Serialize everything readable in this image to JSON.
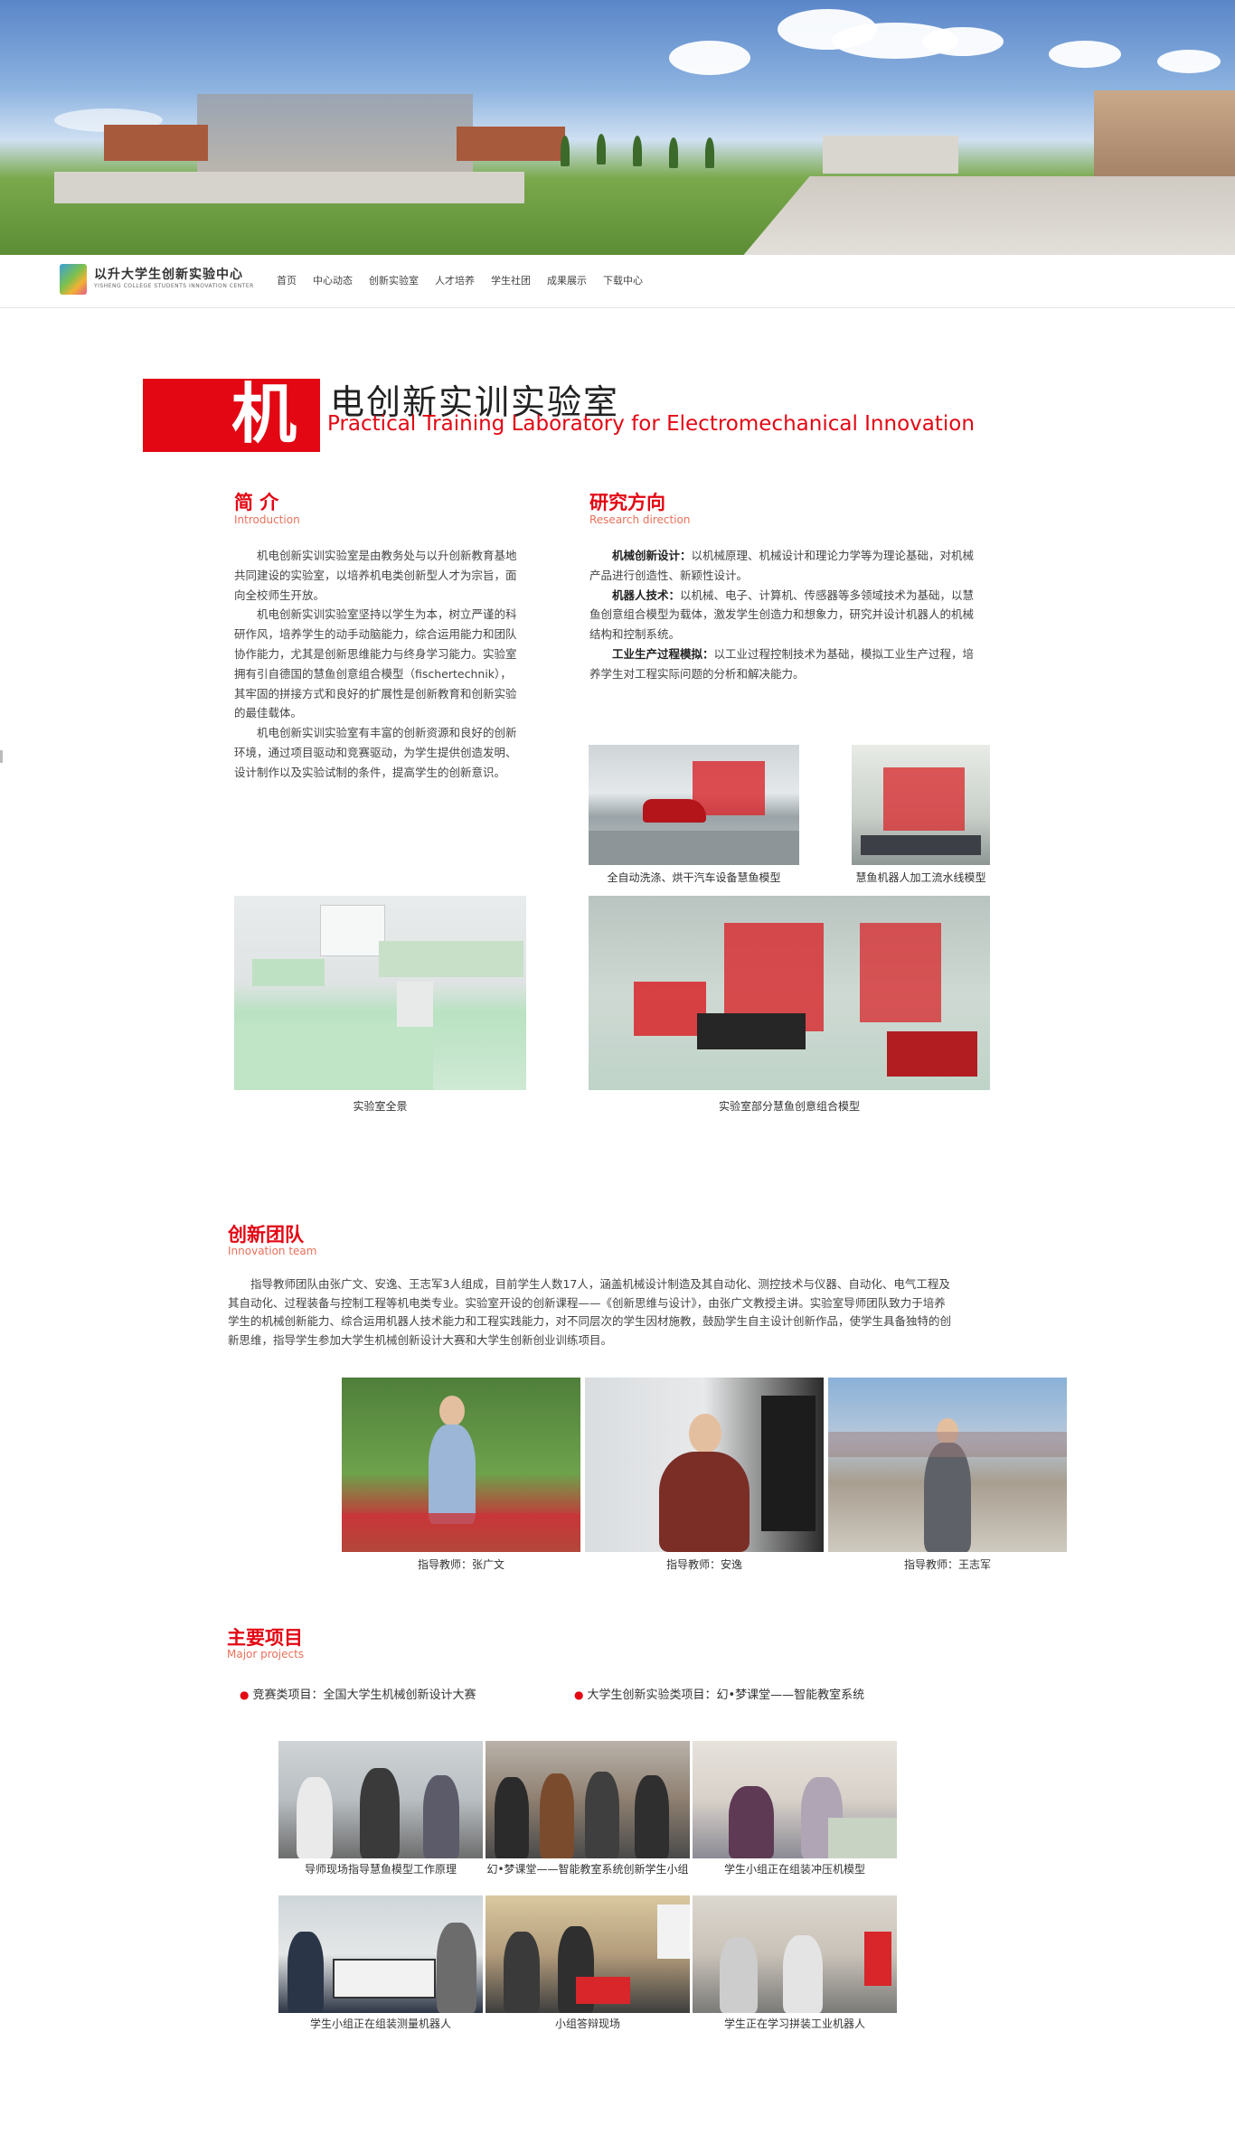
{
  "header": {
    "logo": {
      "cn": "以升大学生创新实验中心",
      "en": "YISHENG COLLEGE STUDENTS INNOVATION CENTER"
    },
    "menu": [
      "首页",
      "中心动态",
      "创新实验室",
      "人才培养",
      "学生社团",
      "成果展示",
      "下载中心"
    ]
  },
  "title": {
    "char": "机",
    "cn": "电创新实训实验室",
    "en": "Practical Training Laboratory for Electromechanical Innovation"
  },
  "intro": {
    "heading_cn": "简 介",
    "heading_en": "Introduction",
    "paragraphs": [
      "机电创新实训实验室是由教务处与以升创新教育基地共同建设的实验室，以培养机电类创新型人才为宗旨，面向全校师生开放。",
      "机电创新实训实验室坚持以学生为本，树立严谨的科研作风，培养学生的动手动脑能力，综合运用能力和团队协作能力，尤其是创新思维能力与终身学习能力。实验室拥有引自德国的慧鱼创意组合模型（fischertechnik），其牢固的拼接方式和良好的扩展性是创新教育和创新实验的最佳载体。",
      "机电创新实训实验室有丰富的创新资源和良好的创新环境，通过项目驱动和竞赛驱动，为学生提供创造发明、设计制作以及实验试制的条件，提高学生的创新意识。"
    ]
  },
  "research": {
    "heading_cn": "研究方向",
    "heading_en": "Research direction",
    "items": [
      {
        "title": "机械创新设计：",
        "text": "以机械原理、机械设计和理论力学等为理论基础，对机械产品进行创造性、新颖性设计。"
      },
      {
        "title": "机器人技术：",
        "text": "以机械、电子、计算机、传感器等多领域技术为基础，以慧鱼创意组合模型为载体，激发学生创造力和想象力，研究并设计机器人的机械结构和控制系统。"
      },
      {
        "title": "工业生产过程模拟：",
        "text": "以工业过程控制技术为基础，模拟工业生产过程，培养学生对工程实际问题的分析和解决能力。"
      }
    ]
  },
  "lab_photos": [
    {
      "caption": "全自动洗涤、烘干汽车设备慧鱼模型"
    },
    {
      "caption": "慧鱼机器人加工流水线模型"
    },
    {
      "caption": "实验室全景"
    },
    {
      "caption": "实验室部分慧鱼创意组合模型"
    }
  ],
  "team": {
    "heading_cn": "创新团队",
    "heading_en": "Innovation team",
    "text": "指导教师团队由张广文、安逸、王志军3人组成，目前学生人数17人，涵盖机械设计制造及其自动化、测控技术与仪器、自动化、电气工程及其自动化、过程装备与控制工程等机电类专业。实验室开设的创新课程——《创新思维与设计》，由张广文教授主讲。实验室导师团队致力于培养学生的机械创新能力、综合运用机器人技术能力和工程实践能力，对不同层次的学生因材施教，鼓励学生自主设计创新作品，使学生具备独特的创新思维，指导学生参加大学生机械创新设计大赛和大学生创新创业训练项目。",
    "members": [
      {
        "caption": "指导教师：张广文"
      },
      {
        "caption": "指导教师：安逸"
      },
      {
        "caption": "指导教师：王志军"
      }
    ]
  },
  "projects": {
    "heading_cn": "主要项目",
    "heading_en": "Major projects",
    "bullets": [
      "竞赛类项目：全国大学生机械创新设计大赛",
      "大学生创新实验类项目：幻•梦课堂——智能教室系统"
    ],
    "gallery": [
      {
        "caption": "导师现场指导慧鱼模型工作原理"
      },
      {
        "caption": "幻•梦课堂——智能教室系统创新学生小组"
      },
      {
        "caption": "学生小组正在组装冲压机模型"
      },
      {
        "caption": "学生小组正在组装测量机器人"
      },
      {
        "caption": "小组答辩现场"
      },
      {
        "caption": "学生正在学习拼装工业机器人"
      }
    ]
  },
  "colors": {
    "accent": "#e30613",
    "accent_light": "#e9705a",
    "text": "#444444"
  }
}
